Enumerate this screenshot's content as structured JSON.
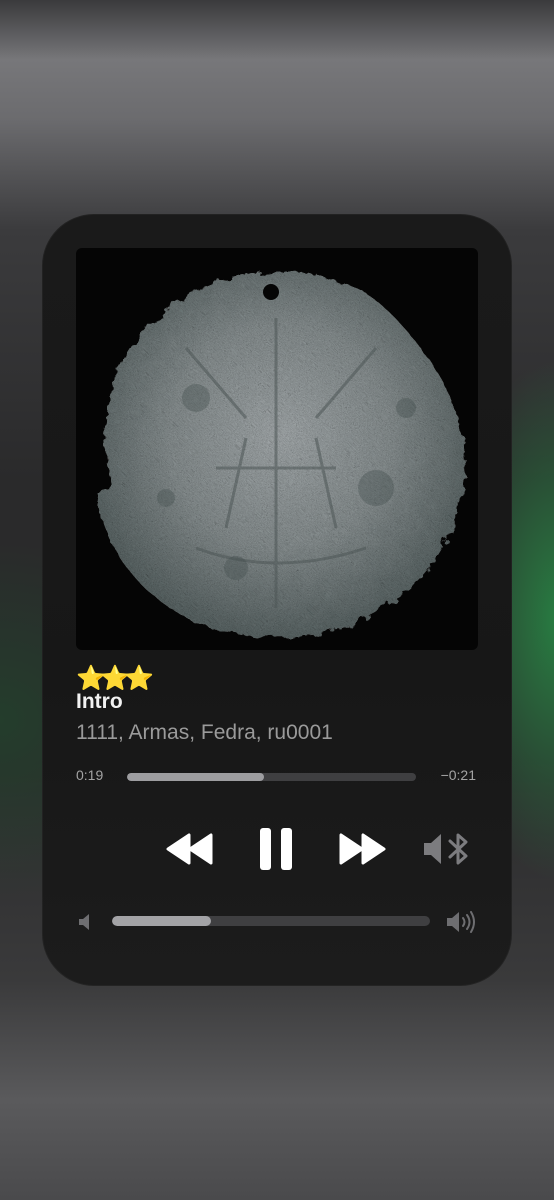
{
  "now_playing": {
    "rating_stars": [
      "⭐",
      "⭐",
      "⭐"
    ],
    "rating": 3,
    "title": "Intro",
    "artist": "1111, Armas, Fedra, ru0001",
    "artwork_icon": "album-artwork-coin"
  },
  "progress": {
    "elapsed": "0:19",
    "remaining": "−0:21",
    "fraction": 0.475
  },
  "controls": {
    "rewind_icon": "rewind-icon",
    "pause_icon": "pause-icon",
    "forward_icon": "fast-forward-icon",
    "output_icon": "bluetooth-speaker-icon"
  },
  "volume": {
    "fraction": 0.31,
    "min_icon": "volume-min-icon",
    "max_icon": "volume-max-icon"
  },
  "colors": {
    "panel": "#1a1a1a",
    "track": "#3f3f41",
    "fill": "#9d9da0",
    "star": "#f5c518",
    "accent_glow": "#2e8c4a"
  }
}
